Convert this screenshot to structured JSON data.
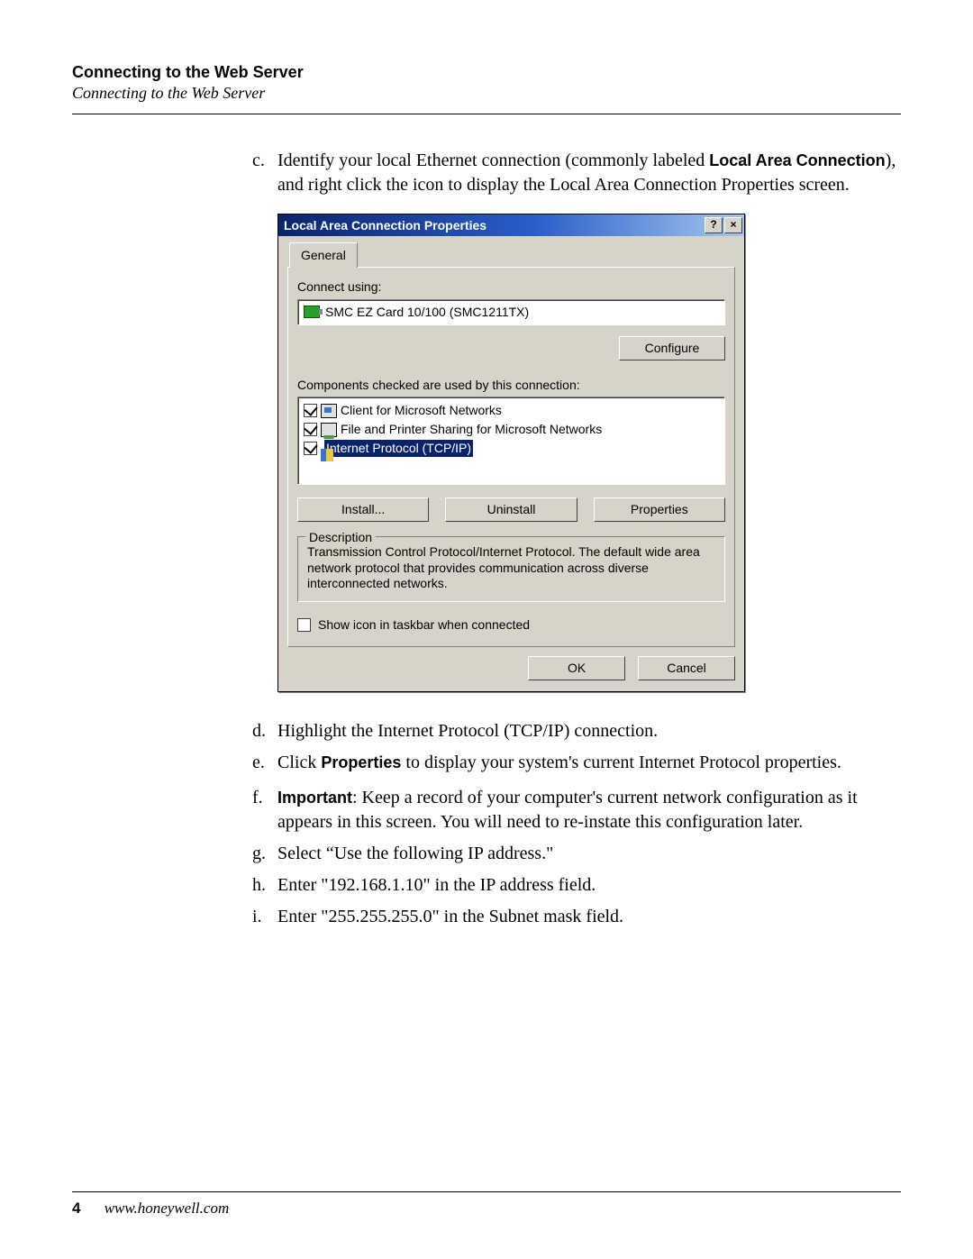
{
  "header": {
    "title_bold": "Connecting to the Web Server",
    "title_italic": "Connecting to the Web Server"
  },
  "steps": {
    "c": {
      "marker": "c.",
      "pre": "Identify your local Ethernet connection (commonly labeled ",
      "bold1": "Local Area Connection",
      "post": "), and right click the icon to display the Local Area Connection Properties screen."
    },
    "d": {
      "marker": "d.",
      "text": "Highlight the Internet Protocol (TCP/IP) connection."
    },
    "e": {
      "marker": "e.",
      "pre": "Click ",
      "bold": "Properties",
      "post": " to display your system's current Internet Protocol properties."
    },
    "f": {
      "marker": "f.",
      "bold": "Important",
      "post": ": Keep a record of your computer's current network configuration as it appears in this screen. You will need to re-instate this configuration later."
    },
    "g": {
      "marker": "g.",
      "text": "Select “Use the following IP address.\""
    },
    "h": {
      "marker": "h.",
      "text": "Enter \"192.168.1.10\" in the IP address field."
    },
    "i": {
      "marker": "i.",
      "text": "Enter \"255.255.255.0\" in the Subnet mask field."
    }
  },
  "dialog": {
    "title": "Local Area Connection Properties",
    "help": "?",
    "close": "×",
    "tab_general": "General",
    "connect_using_label": "Connect using:",
    "adapter": "SMC EZ Card 10/100 (SMC1211TX)",
    "configure": "Configure",
    "components_label": "Components checked are used by this connection:",
    "items": [
      {
        "label": "Client for Microsoft Networks"
      },
      {
        "label": "File and Printer Sharing for Microsoft Networks"
      },
      {
        "label": "Internet Protocol (TCP/IP)"
      }
    ],
    "install": "Install...",
    "uninstall": "Uninstall",
    "properties": "Properties",
    "description_title": "Description",
    "description_text": "Transmission Control Protocol/Internet Protocol. The default wide area network protocol that provides communication across diverse interconnected networks.",
    "show_icon": "Show icon in taskbar when connected",
    "ok": "OK",
    "cancel": "Cancel"
  },
  "footer": {
    "page": "4",
    "url": "www.honeywell.com"
  }
}
